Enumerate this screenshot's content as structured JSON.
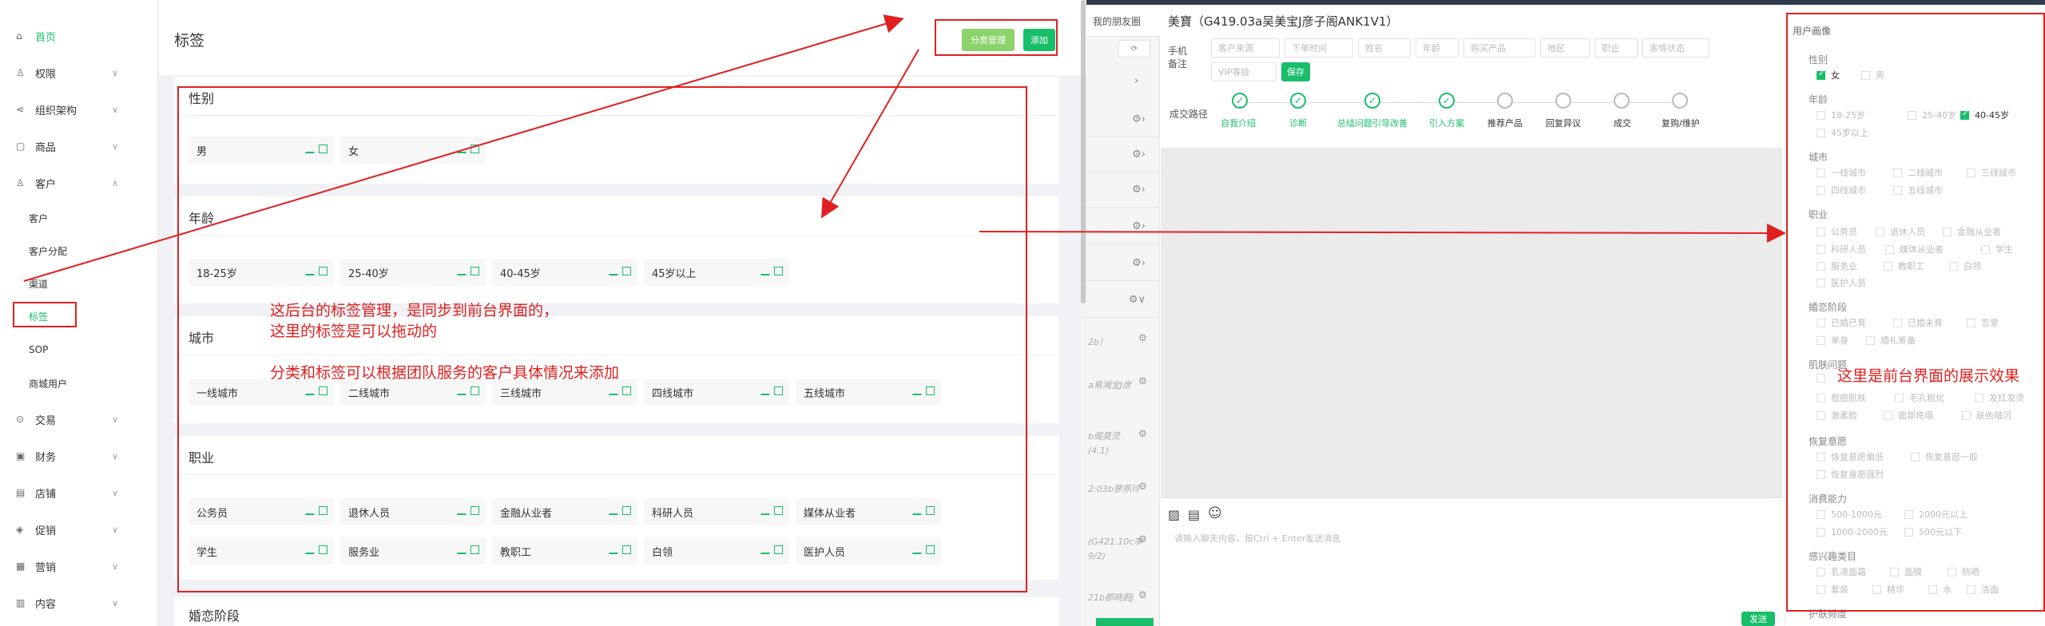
{
  "sidebar": {
    "items": [
      {
        "label": "首页",
        "icon": "home-icon"
      },
      {
        "label": "权限",
        "icon": "user-icon",
        "chevron": "down"
      },
      {
        "label": "组织架构",
        "icon": "share-icon",
        "chevron": "down"
      },
      {
        "label": "商品",
        "icon": "box-icon",
        "chevron": "down"
      },
      {
        "label": "客户",
        "icon": "user-group-icon",
        "chevron": "up"
      },
      {
        "label": "交易",
        "icon": "trade-icon",
        "chevron": "down"
      },
      {
        "label": "财务",
        "icon": "finance-icon",
        "chevron": "down"
      },
      {
        "label": "店铺",
        "icon": "shop-icon",
        "chevron": "down"
      },
      {
        "label": "促销",
        "icon": "promo-icon",
        "chevron": "down"
      },
      {
        "label": "营销",
        "icon": "marketing-icon",
        "chevron": "down"
      },
      {
        "label": "内容",
        "icon": "content-icon",
        "chevron": "down"
      }
    ],
    "sub_items": [
      "客户",
      "客户分配",
      "渠道",
      "标签",
      "SOP",
      "商城用户"
    ],
    "active": "标签"
  },
  "page": {
    "title": "标签",
    "btn_category": "分类管理",
    "btn_add": "添加"
  },
  "tag_groups": [
    {
      "title": "性别",
      "tags": [
        "男",
        "女"
      ]
    },
    {
      "title": "年龄",
      "tags": [
        "18-25岁",
        "25-40岁",
        "40-45岁",
        "45岁以上"
      ]
    },
    {
      "title": "城市",
      "tags": [
        "一线城市",
        "二线城市",
        "三线城市",
        "四线城市",
        "五线城市"
      ]
    },
    {
      "title": "职业",
      "tags": [
        "公务员",
        "退休人员",
        "金融从业者",
        "科研人员",
        "媒体从业者",
        "学生",
        "服务业",
        "教职工",
        "白领",
        "医护人员"
      ]
    },
    {
      "title": "婚恋阶段",
      "tags": []
    }
  ],
  "annotations": {
    "left_1": "这后台的标签管理，是同步到前台界面的，",
    "left_2": "这里的标签是可以拖动的",
    "left_3": "分类和标签可以根据团队服务的客户具体情况来添加",
    "right": "这里是前台界面的展示效果"
  },
  "crm": {
    "friends_header": "我的朋友圈",
    "friend_texts": [
      "2b）",
      "a易湘宝J彦",
      "b阁莫灵",
      "(4.1)",
      "2:03b蓼燕玲",
      "(G421.10c李",
      "9/2)",
      "21b郡晓蔚J"
    ],
    "chat_title": "美寶（G419.03a吴美宝J彦子阁ANK1V1）",
    "phone_label": "手机备注",
    "filters": [
      "客户来源",
      "下单时间",
      "姓名",
      "年龄",
      "购买产品",
      "地区",
      "职业",
      "客情状态"
    ],
    "vip_placeholder": "VIP等级",
    "save_label": "保存",
    "path_label": "成交路径",
    "steps": [
      {
        "label": "自我介绍",
        "done": true
      },
      {
        "label": "诊断",
        "done": true
      },
      {
        "label": "总结问题引导改善",
        "done": true
      },
      {
        "label": "引入方案",
        "done": true
      },
      {
        "label": "推荐产品",
        "done": false
      },
      {
        "label": "回复异议",
        "done": false
      },
      {
        "label": "成交",
        "done": false
      },
      {
        "label": "复购/维护",
        "done": false
      }
    ],
    "input_placeholder": "请输入聊天内容，按Ctrl + Enter发送消息",
    "send_label": "发送"
  },
  "profile": {
    "title": "用户画像",
    "sections": [
      {
        "title": "性别",
        "options": [
          {
            "label": "女",
            "checked": true
          },
          {
            "label": "男",
            "checked": false
          }
        ]
      },
      {
        "title": "年龄",
        "options": [
          {
            "label": "18-25岁",
            "checked": false
          },
          {
            "label": "25-40岁",
            "checked": false
          },
          {
            "label": "40-45岁",
            "checked": true
          },
          {
            "label": "45岁以上",
            "checked": false
          }
        ]
      },
      {
        "title": "城市",
        "options": [
          {
            "label": "一线城市"
          },
          {
            "label": "二线城市"
          },
          {
            "label": "三线城市"
          },
          {
            "label": "四线城市"
          },
          {
            "label": "五线城市"
          }
        ]
      },
      {
        "title": "职业",
        "options": [
          {
            "label": "公务员"
          },
          {
            "label": "退休人员"
          },
          {
            "label": "金融从业者"
          },
          {
            "label": "科研人员"
          },
          {
            "label": "媒体从业者"
          },
          {
            "label": "学生"
          },
          {
            "label": "服务业"
          },
          {
            "label": "教职工"
          },
          {
            "label": "白领"
          },
          {
            "label": "医护人员"
          }
        ]
      },
      {
        "title": "婚恋阶段",
        "options": [
          {
            "label": "已婚已育"
          },
          {
            "label": "已婚未育"
          },
          {
            "label": "恋爱"
          },
          {
            "label": "单身"
          },
          {
            "label": "婚礼筹备"
          }
        ]
      },
      {
        "title": "肌肤问题",
        "options": [
          {
            "label": ""
          },
          {
            "label": ""
          },
          {
            "label": ""
          },
          {
            "label": "痘痘肌肤"
          },
          {
            "label": "毛孔粗化"
          },
          {
            "label": "发红发烫"
          },
          {
            "label": "激素脸"
          },
          {
            "label": "面部垮塌"
          },
          {
            "label": "肤色暗沉"
          }
        ]
      },
      {
        "title": "恢复意愿",
        "options": [
          {
            "label": "恢复意愿偏低"
          },
          {
            "label": "恢复意愿一般"
          },
          {
            "label": "恢复意愿强烈"
          }
        ]
      },
      {
        "title": "消费能力",
        "options": [
          {
            "label": "500-1000元"
          },
          {
            "label": "2000元以上"
          },
          {
            "label": "1000-2000元"
          },
          {
            "label": "500元以下"
          }
        ]
      },
      {
        "title": "感兴趣类目",
        "options": [
          {
            "label": "乳液面霜"
          },
          {
            "label": "面膜"
          },
          {
            "label": "防晒"
          },
          {
            "label": "套装"
          },
          {
            "label": "精华"
          },
          {
            "label": "水"
          },
          {
            "label": "洁面"
          }
        ]
      },
      {
        "title": "护肤频度",
        "options": []
      }
    ]
  },
  "colors": {
    "accent": "#19be6b",
    "annotation": "#e02020"
  }
}
